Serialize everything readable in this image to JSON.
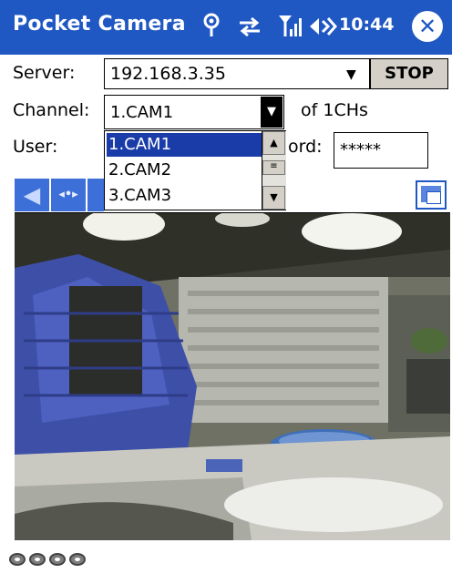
{
  "titlebar": {
    "app_title": "Pocket Camera",
    "clock": "10:44",
    "close_glyph": "✕",
    "icons": [
      "connectivity-icon",
      "sync-icon",
      "signal-icon",
      "volume-icon"
    ]
  },
  "server": {
    "label": "Server:",
    "value": "192.168.3.35",
    "stop_label": "STOP"
  },
  "channel": {
    "label": "Channel:",
    "selected": "1.CAM1",
    "count_text": "of 1CHs",
    "options": [
      "1.CAM1",
      "2.CAM2",
      "3.CAM3"
    ]
  },
  "user": {
    "label": "User:"
  },
  "password": {
    "label_visible": "ord:",
    "value": "*****"
  },
  "toolbar": {
    "icons": [
      "left-arrow-icon",
      "pan-icon",
      "right-arrow-icon",
      "window-icon"
    ]
  },
  "status": {
    "dots": 4
  },
  "colors": {
    "titlebar": "#1f57c3",
    "selection": "#1a3ca8",
    "button_face": "#d4d0c8"
  }
}
